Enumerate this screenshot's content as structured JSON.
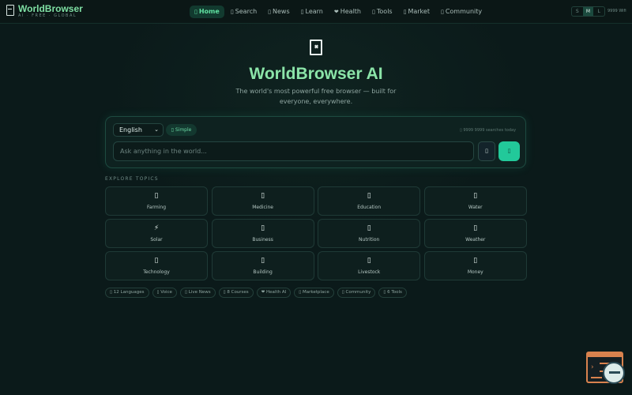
{
  "header": {
    "brand": "WorldBrowser",
    "tagline": "AI · FREE · GLOBAL",
    "nav": [
      {
        "glyph": "▯",
        "label": "Home",
        "active": true
      },
      {
        "glyph": "▯",
        "label": "Search"
      },
      {
        "glyph": "▯",
        "label": "News"
      },
      {
        "glyph": "▯",
        "label": "Learn"
      },
      {
        "glyph": "❤",
        "label": "Health"
      },
      {
        "glyph": "▯",
        "label": "Tools"
      },
      {
        "glyph": "▯",
        "label": "Market"
      },
      {
        "glyph": "▯",
        "label": "Community"
      }
    ],
    "text_sizes": [
      "S",
      "M",
      "L"
    ],
    "selected_size": "M",
    "wifi_status": "9999 Wifi"
  },
  "hero": {
    "title": "WorldBrowser AI",
    "subtitle": "The world's most powerful free browser — built for everyone, everywhere."
  },
  "search": {
    "language": "English",
    "mode_label": "▯ Simple",
    "counter": "▯ 9999 9999 searches today",
    "placeholder": "Ask anything in the world...",
    "mic_glyph": "▯",
    "go_glyph": "▯"
  },
  "topics": {
    "label": "EXPLORE TOPICS",
    "items": [
      {
        "icon": "▯",
        "label": "Farming"
      },
      {
        "icon": "▯",
        "label": "Medicine"
      },
      {
        "icon": "▯",
        "label": "Education"
      },
      {
        "icon": "▯",
        "label": "Water"
      },
      {
        "icon": "⚡",
        "label": "Solar"
      },
      {
        "icon": "▯",
        "label": "Business"
      },
      {
        "icon": "▯",
        "label": "Nutrition"
      },
      {
        "icon": "▯",
        "label": "Weather"
      },
      {
        "icon": "▯",
        "label": "Technology"
      },
      {
        "icon": "▯",
        "label": "Building"
      },
      {
        "icon": "▯",
        "label": "Livestock"
      },
      {
        "icon": "▯",
        "label": "Money"
      }
    ]
  },
  "features": [
    "▯ 12 Languages",
    "▯ Voice",
    "▯ Live News",
    "▯ 8 Courses",
    "❤ Health AI",
    "▯ Marketplace",
    "▯ Community",
    "▯ 6 Tools"
  ]
}
